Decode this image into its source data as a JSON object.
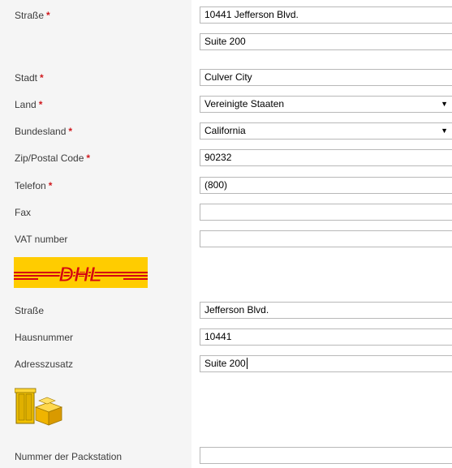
{
  "form": {
    "street": {
      "label": "Straße",
      "required": "*",
      "value1": "10441 Jefferson Blvd.",
      "value2": "Suite 200"
    },
    "city": {
      "label": "Stadt",
      "required": "*",
      "value": "Culver City"
    },
    "country": {
      "label": "Land",
      "required": "*",
      "value": "Vereinigte Staaten"
    },
    "state": {
      "label": "Bundesland",
      "required": "*",
      "value": "California"
    },
    "zip": {
      "label": "Zip/Postal Code",
      "required": "*",
      "value": "90232"
    },
    "phone": {
      "label": "Telefon",
      "required": "*",
      "value": "(800)"
    },
    "fax": {
      "label": "Fax",
      "value": ""
    },
    "vat": {
      "label": "VAT number",
      "value": ""
    }
  },
  "dhl": {
    "logo_text": "DHL",
    "street": {
      "label": "Straße",
      "value": "Jefferson Blvd."
    },
    "house_number": {
      "label": "Hausnummer",
      "value": "10441"
    },
    "address_extra": {
      "label": "Adresszusatz",
      "value": "Suite 200"
    },
    "packstation": {
      "label": "Nummer der Packstation",
      "value": ""
    }
  },
  "colors": {
    "required": "#d0191e",
    "dhl_yellow": "#ffcc00",
    "dhl_red": "#d40511",
    "label_bg": "#f5f5f5"
  },
  "icons": {
    "select_arrow": "▼",
    "packstation": "packstation-icon"
  }
}
